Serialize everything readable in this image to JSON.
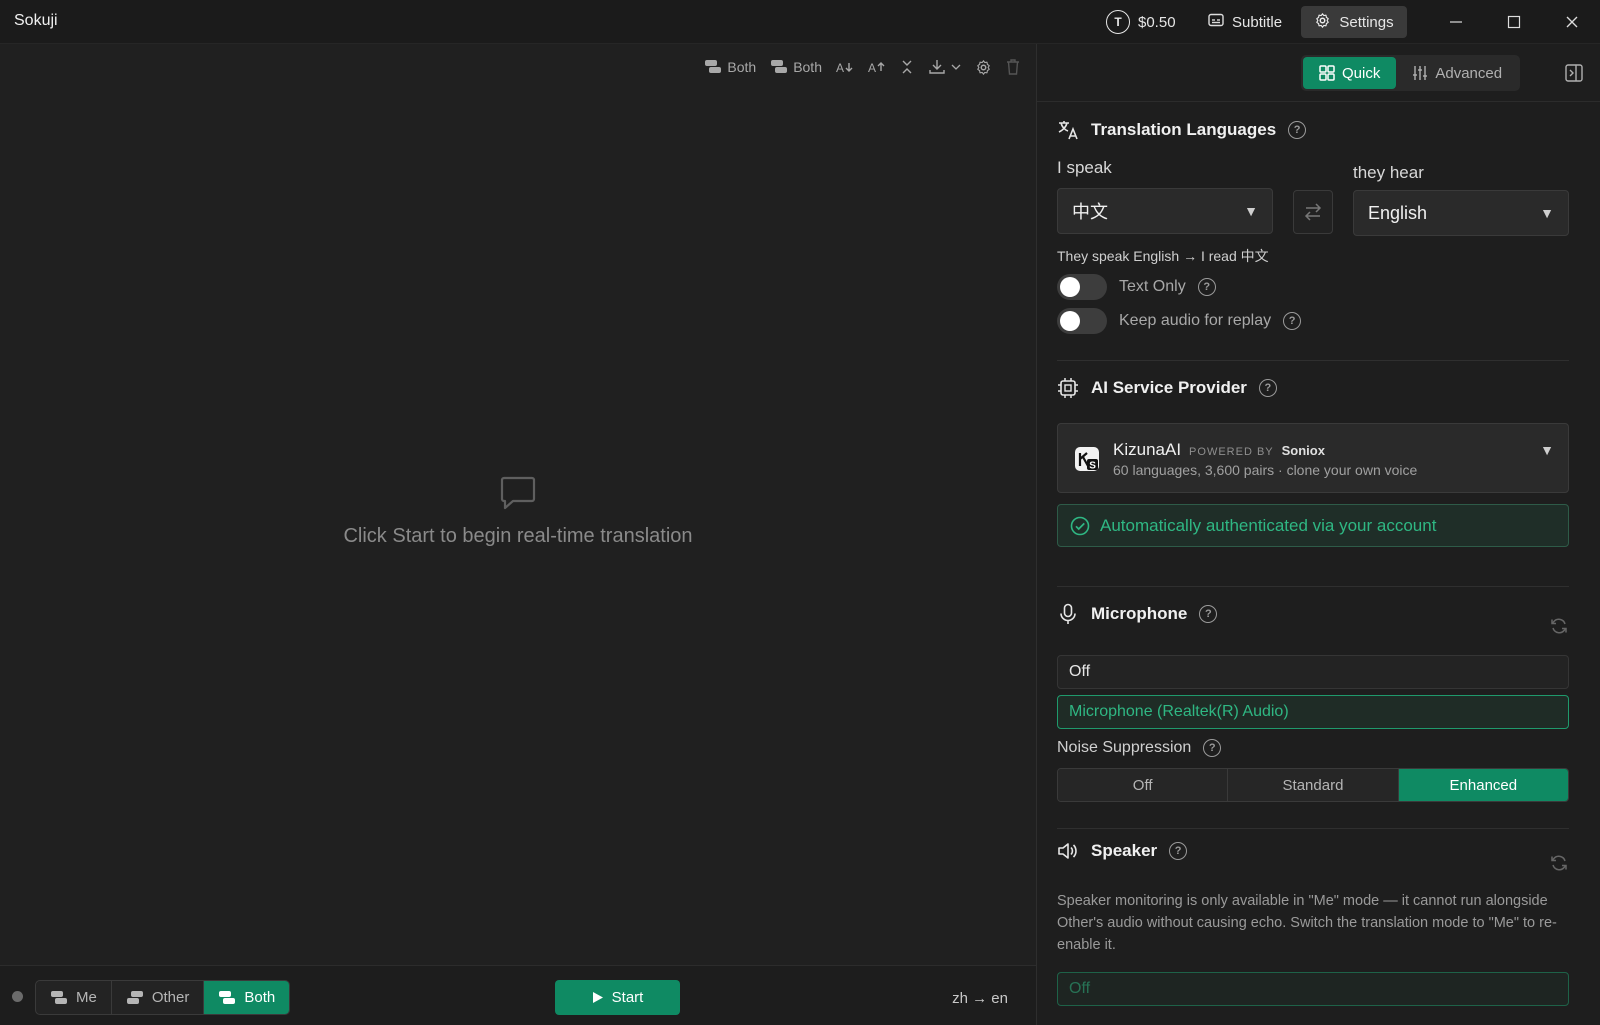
{
  "titlebar": {
    "app_name": "Sokuji",
    "balance": "$0.50",
    "coin_letter": "T",
    "subtitle_label": "Subtitle",
    "settings_label": "Settings"
  },
  "left_toolbar": {
    "speaker_filter_1": "Both",
    "speaker_filter_2": "Both"
  },
  "empty_state": {
    "message": "Click Start to begin real-time translation"
  },
  "bottom_bar": {
    "modes": [
      "Me",
      "Other",
      "Both"
    ],
    "active_mode": "Both",
    "start_label": "Start",
    "lang_pair": "zh → en"
  },
  "panel": {
    "tabs": {
      "quick": "Quick",
      "advanced": "Advanced"
    },
    "active_tab": "Quick",
    "translation": {
      "title": "Translation Languages",
      "i_speak_label": "I speak",
      "i_speak_value": "中文",
      "they_hear_label": "they hear",
      "they_hear_value": "English",
      "hint": "They speak English → I read 中文",
      "text_only_label": "Text Only",
      "text_only_on": false,
      "keep_audio_label": "Keep audio for replay",
      "keep_audio_on": false
    },
    "provider": {
      "title": "AI Service Provider",
      "name": "KizunaAI",
      "powered_by": "POWERED BY",
      "powered_name": "Soniox",
      "description": "60 languages, 3,600 pairs · clone your own voice",
      "auth_message": "Automatically authenticated via your account"
    },
    "microphone": {
      "title": "Microphone",
      "options": [
        "Off",
        "Microphone (Realtek(R) Audio)"
      ],
      "selected": "Microphone (Realtek(R) Audio)",
      "noise_label": "Noise Suppression",
      "noise_options": [
        "Off",
        "Standard",
        "Enhanced"
      ],
      "noise_selected": "Enhanced"
    },
    "speaker": {
      "title": "Speaker",
      "note": "Speaker monitoring is only available in \"Me\" mode — it cannot run alongside Other's audio without causing echo. Switch the translation mode to \"Me\" to re-enable it.",
      "option_off": "Off"
    }
  },
  "colors": {
    "accent": "#0f8a63",
    "accent_text": "#2fb783",
    "background": "#202020"
  }
}
